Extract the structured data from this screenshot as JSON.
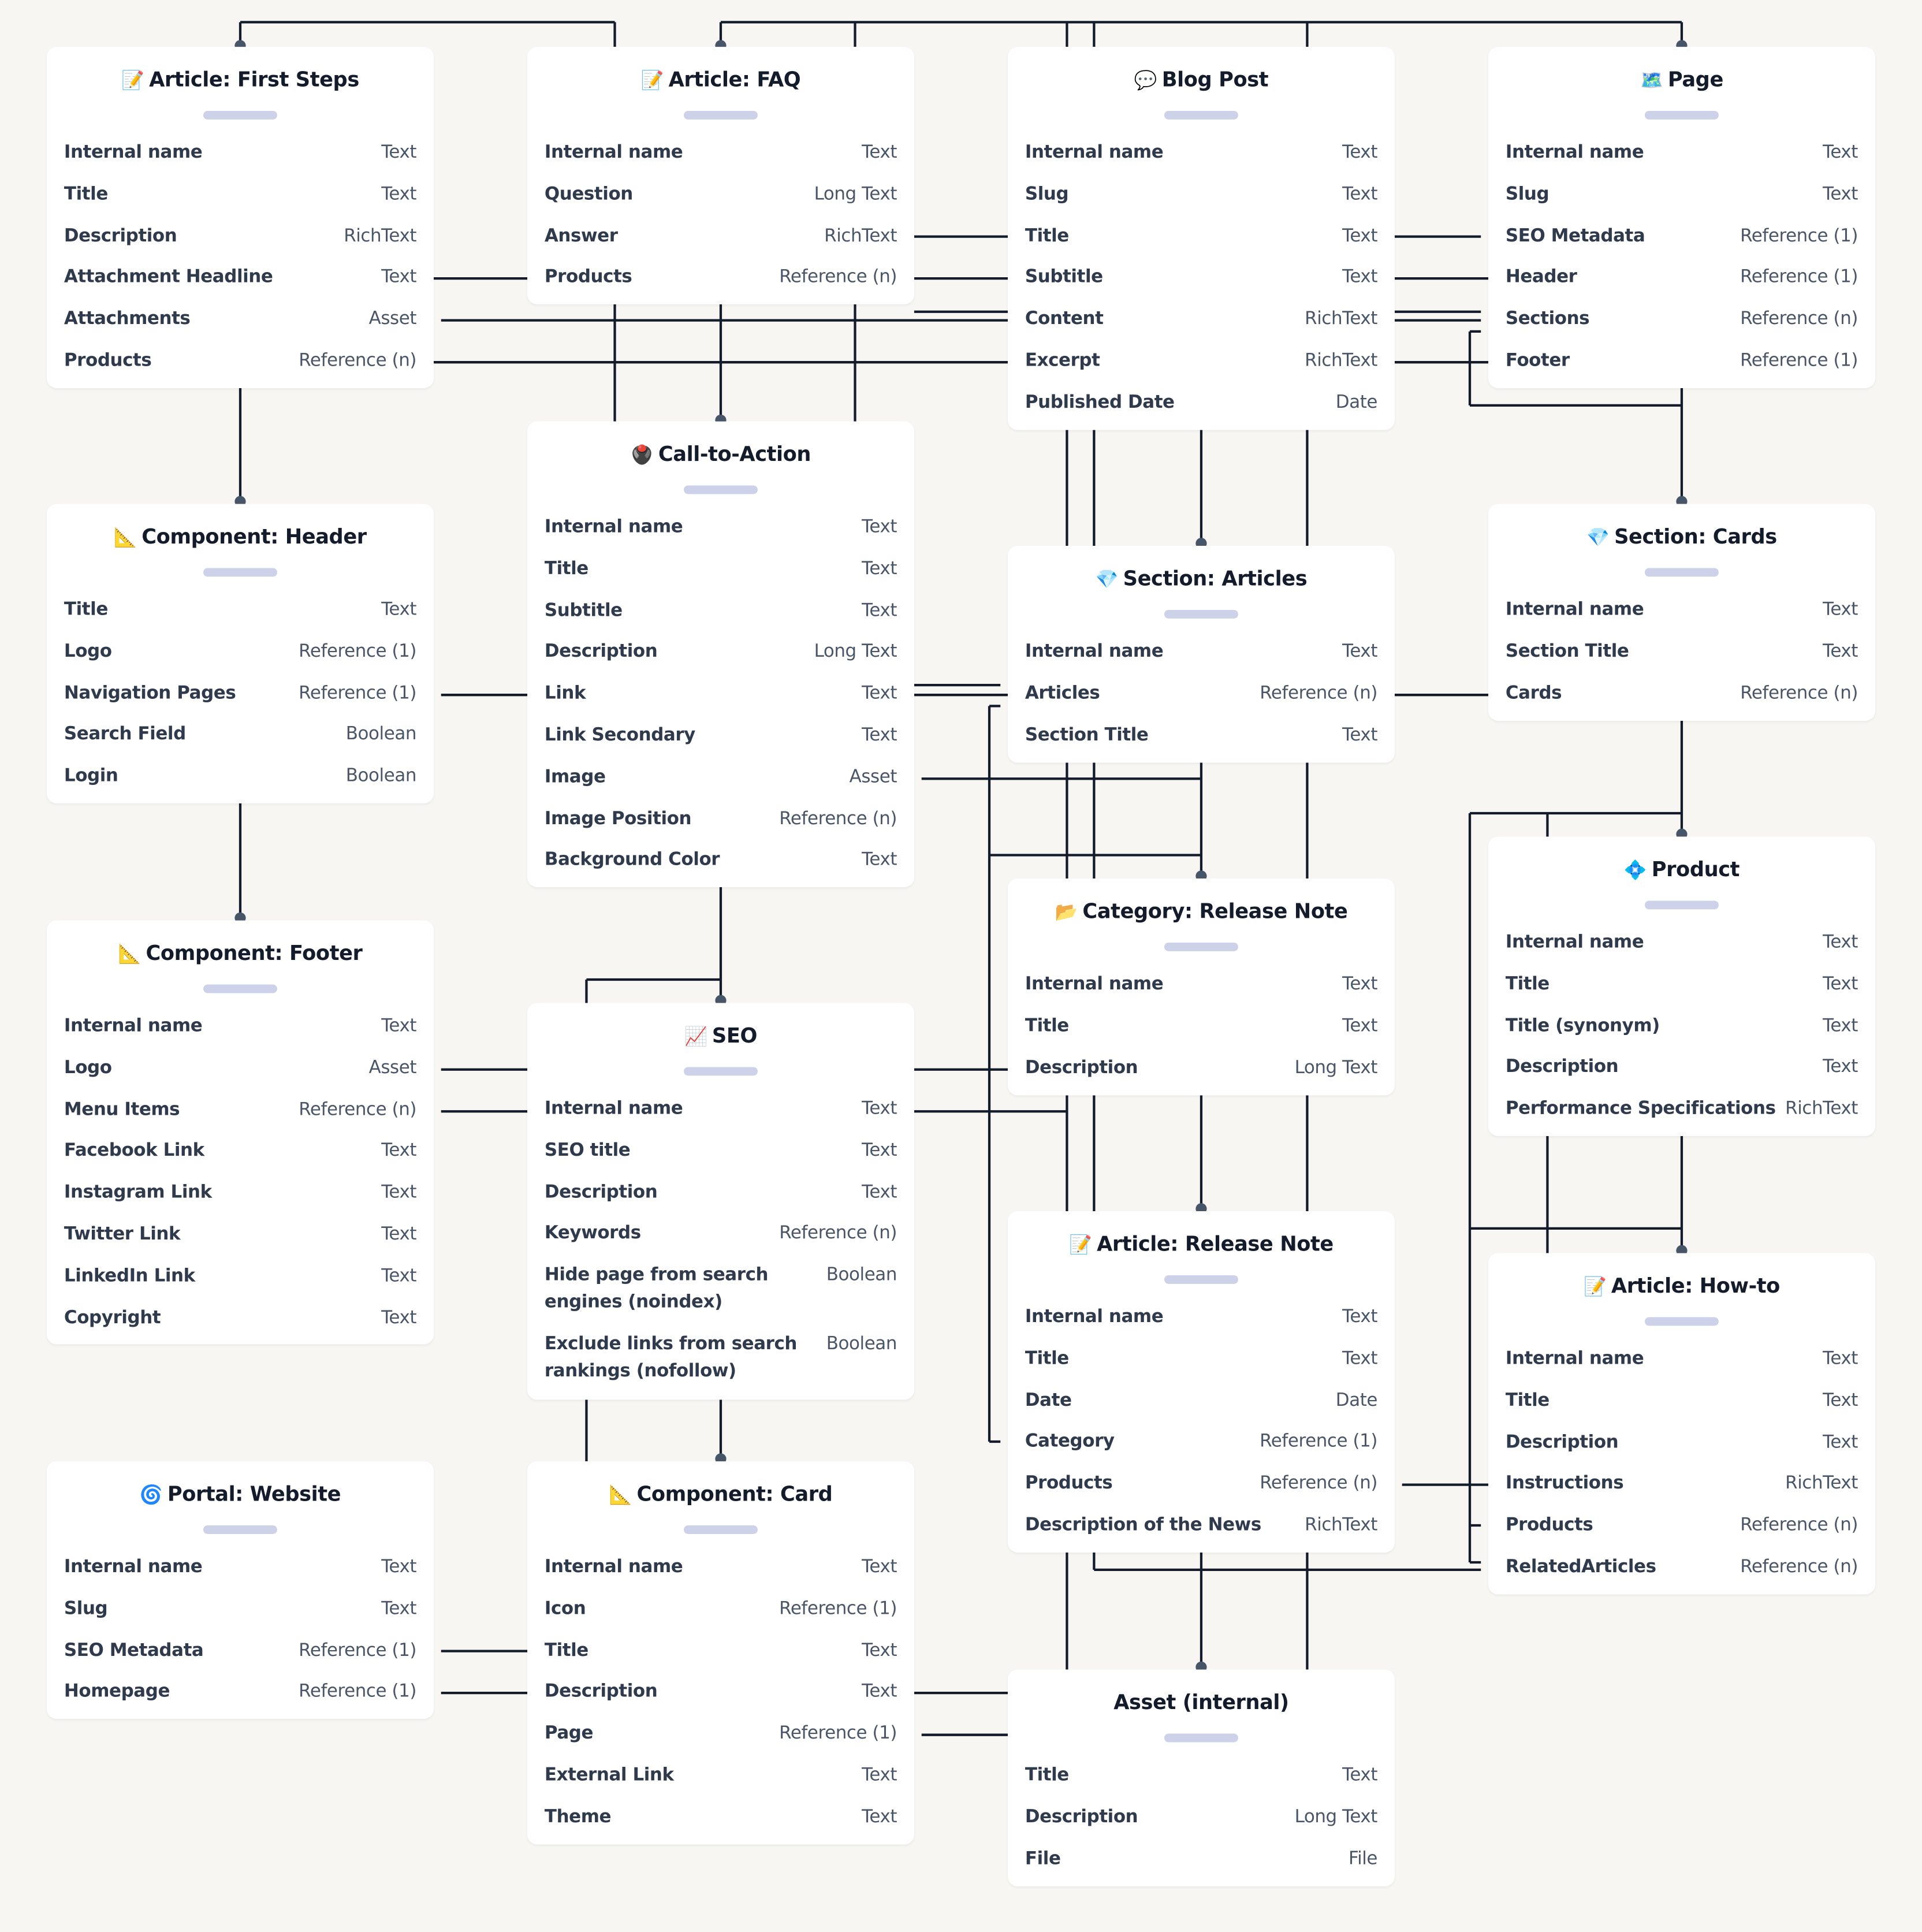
{
  "colors": {
    "background": "#f7f6f3",
    "card": "#ffffff",
    "connector": "#141b2b",
    "anchor": "#475569",
    "pill": "#cdd2e8"
  },
  "models": [
    {
      "id": "article-first-steps",
      "icon": "📝",
      "icon_name": "memo-icon",
      "title": "Article: First Steps",
      "fields": [
        {
          "name": "Internal name",
          "type": "Text"
        },
        {
          "name": "Title",
          "type": "Text"
        },
        {
          "name": "Description",
          "type": "RichText"
        },
        {
          "name": "Attachment Headline",
          "type": "Text"
        },
        {
          "name": "Attachments",
          "type": "Asset"
        },
        {
          "name": "Products",
          "type": "Reference (n)"
        }
      ]
    },
    {
      "id": "article-faq",
      "icon": "📝",
      "icon_name": "memo-icon",
      "title": "Article: FAQ",
      "fields": [
        {
          "name": "Internal name",
          "type": "Text"
        },
        {
          "name": "Question",
          "type": "Long Text"
        },
        {
          "name": "Answer",
          "type": "RichText"
        },
        {
          "name": "Products",
          "type": "Reference (n)"
        }
      ]
    },
    {
      "id": "blog-post",
      "icon": "💬",
      "icon_name": "speech-bubble-icon",
      "title": "Blog Post",
      "fields": [
        {
          "name": "Internal name",
          "type": "Text"
        },
        {
          "name": "Slug",
          "type": "Text"
        },
        {
          "name": "Title",
          "type": "Text"
        },
        {
          "name": "Subtitle",
          "type": "Text"
        },
        {
          "name": "Content",
          "type": "RichText"
        },
        {
          "name": "Excerpt",
          "type": "RichText"
        },
        {
          "name": "Published Date",
          "type": "Date"
        }
      ]
    },
    {
      "id": "page",
      "icon": "🗺️",
      "icon_name": "map-icon",
      "title": "Page",
      "fields": [
        {
          "name": "Internal name",
          "type": "Text"
        },
        {
          "name": "Slug",
          "type": "Text"
        },
        {
          "name": "SEO Metadata",
          "type": "Reference (1)"
        },
        {
          "name": "Header",
          "type": "Reference (1)"
        },
        {
          "name": "Sections",
          "type": "Reference (n)"
        },
        {
          "name": "Footer",
          "type": "Reference (1)"
        }
      ]
    },
    {
      "id": "call-to-action",
      "icon": "🖲️",
      "icon_name": "trackball-icon",
      "title": "Call-to-Action",
      "fields": [
        {
          "name": "Internal name",
          "type": "Text"
        },
        {
          "name": "Title",
          "type": "Text"
        },
        {
          "name": "Subtitle",
          "type": "Text"
        },
        {
          "name": "Description",
          "type": "Long Text"
        },
        {
          "name": "Link",
          "type": "Text"
        },
        {
          "name": "Link Secondary",
          "type": "Text"
        },
        {
          "name": "Image",
          "type": "Asset"
        },
        {
          "name": "Image Position",
          "type": "Reference (n)"
        },
        {
          "name": "Background Color",
          "type": "Text"
        }
      ]
    },
    {
      "id": "component-header",
      "icon": "📐",
      "icon_name": "triangular-ruler-icon",
      "title": "Component: Header",
      "fields": [
        {
          "name": "Title",
          "type": "Text"
        },
        {
          "name": "Logo",
          "type": "Reference (1)"
        },
        {
          "name": "Navigation Pages",
          "type": "Reference (1)"
        },
        {
          "name": "Search Field",
          "type": "Boolean"
        },
        {
          "name": "Login",
          "type": "Boolean"
        }
      ]
    },
    {
      "id": "section-articles",
      "icon": "💎",
      "icon_name": "gem-icon",
      "title": "Section: Articles",
      "fields": [
        {
          "name": "Internal name",
          "type": "Text"
        },
        {
          "name": "Articles",
          "type": "Reference (n)"
        },
        {
          "name": "Section Title",
          "type": "Text"
        }
      ]
    },
    {
      "id": "section-cards",
      "icon": "💎",
      "icon_name": "gem-icon",
      "title": "Section: Cards",
      "fields": [
        {
          "name": "Internal name",
          "type": "Text"
        },
        {
          "name": "Section Title",
          "type": "Text"
        },
        {
          "name": "Cards",
          "type": "Reference (n)"
        }
      ]
    },
    {
      "id": "category-release-note",
      "icon": "📂",
      "icon_name": "open-folder-icon",
      "title": "Category: Release Note",
      "fields": [
        {
          "name": "Internal name",
          "type": "Text"
        },
        {
          "name": "Title",
          "type": "Text"
        },
        {
          "name": "Description",
          "type": "Long Text"
        }
      ]
    },
    {
      "id": "product",
      "icon": "💠",
      "icon_name": "diamond-dot-icon",
      "title": "Product",
      "fields": [
        {
          "name": "Internal name",
          "type": "Text"
        },
        {
          "name": "Title",
          "type": "Text"
        },
        {
          "name": "Title (synonym)",
          "type": "Text"
        },
        {
          "name": "Description",
          "type": "Text"
        },
        {
          "name": "Performance Specifications",
          "type": "RichText"
        }
      ]
    },
    {
      "id": "component-footer",
      "icon": "📐",
      "icon_name": "triangular-ruler-icon",
      "title": "Component: Footer",
      "fields": [
        {
          "name": "Internal name",
          "type": "Text"
        },
        {
          "name": "Logo",
          "type": "Asset"
        },
        {
          "name": "Menu Items",
          "type": "Reference (n)"
        },
        {
          "name": "Facebook Link",
          "type": "Text"
        },
        {
          "name": "Instagram Link",
          "type": "Text"
        },
        {
          "name": "Twitter Link",
          "type": "Text"
        },
        {
          "name": "LinkedIn Link",
          "type": "Text"
        },
        {
          "name": "Copyright",
          "type": "Text"
        }
      ]
    },
    {
      "id": "seo",
      "icon": "📈",
      "icon_name": "chart-increasing-icon",
      "title": "SEO",
      "fields": [
        {
          "name": "Internal name",
          "type": "Text"
        },
        {
          "name": "SEO title",
          "type": "Text"
        },
        {
          "name": "Description",
          "type": "Text"
        },
        {
          "name": "Keywords",
          "type": "Reference (n)"
        },
        {
          "name": "Hide page from search engines (noindex)",
          "type": "Boolean",
          "tall": true
        },
        {
          "name": "Exclude links from search rankings (nofollow)",
          "type": "Boolean",
          "tall": true
        }
      ]
    },
    {
      "id": "article-release-note",
      "icon": "📝",
      "icon_name": "memo-icon",
      "title": "Article: Release Note",
      "fields": [
        {
          "name": "Internal name",
          "type": "Text"
        },
        {
          "name": "Title",
          "type": "Text"
        },
        {
          "name": "Date",
          "type": "Date"
        },
        {
          "name": "Category",
          "type": "Reference (1)"
        },
        {
          "name": "Products",
          "type": "Reference (n)"
        },
        {
          "name": "Description of the News",
          "type": "RichText"
        }
      ]
    },
    {
      "id": "article-how-to",
      "icon": "📝",
      "icon_name": "memo-icon",
      "title": "Article: How-to",
      "fields": [
        {
          "name": "Internal name",
          "type": "Text"
        },
        {
          "name": "Title",
          "type": "Text"
        },
        {
          "name": "Description",
          "type": "Text"
        },
        {
          "name": "Instructions",
          "type": "RichText"
        },
        {
          "name": "Products",
          "type": "Reference (n)"
        },
        {
          "name": "RelatedArticles",
          "type": "Reference (n)"
        }
      ]
    },
    {
      "id": "portal-website",
      "icon": "🌀",
      "icon_name": "cyclone-icon",
      "title": "Portal: Website",
      "fields": [
        {
          "name": "Internal name",
          "type": "Text"
        },
        {
          "name": "Slug",
          "type": "Text"
        },
        {
          "name": "SEO Metadata",
          "type": "Reference (1)"
        },
        {
          "name": "Homepage",
          "type": "Reference (1)"
        }
      ]
    },
    {
      "id": "component-card",
      "icon": "📐",
      "icon_name": "triangular-ruler-icon",
      "title": "Component: Card",
      "fields": [
        {
          "name": "Internal name",
          "type": "Text"
        },
        {
          "name": "Icon",
          "type": "Reference (1)"
        },
        {
          "name": "Title",
          "type": "Text"
        },
        {
          "name": "Description",
          "type": "Text"
        },
        {
          "name": "Page",
          "type": "Reference (1)"
        },
        {
          "name": "External Link",
          "type": "Text"
        },
        {
          "name": "Theme",
          "type": "Text"
        }
      ]
    },
    {
      "id": "asset-internal",
      "icon": "",
      "icon_name": "",
      "title": "Asset (internal)",
      "fields": [
        {
          "name": "Title",
          "type": "Text"
        },
        {
          "name": "Description",
          "type": "Long Text"
        },
        {
          "name": "File",
          "type": "File"
        }
      ]
    }
  ]
}
